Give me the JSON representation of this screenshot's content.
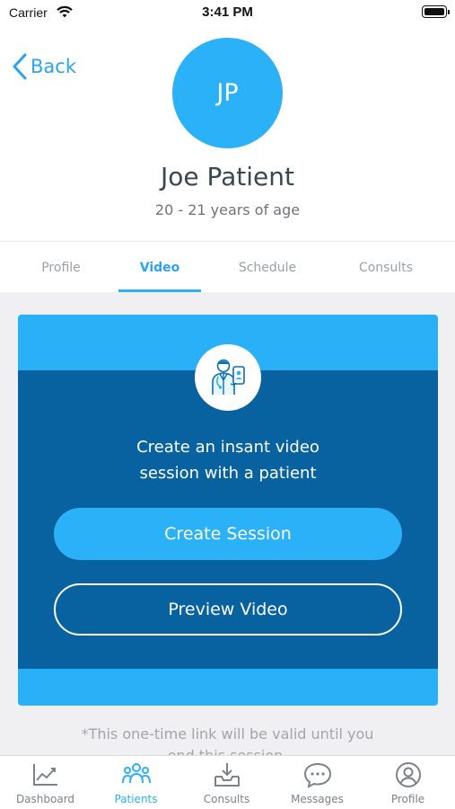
{
  "status_bar": {
    "carrier": "Carrier",
    "time": "3:41 PM"
  },
  "header": {
    "back_label": "Back",
    "avatar_initials": "JP",
    "patient_name": "Joe Patient",
    "patient_age": "20 - 21 years of age"
  },
  "tabs": [
    {
      "label": "Profile",
      "active": false
    },
    {
      "label": "Video",
      "active": true
    },
    {
      "label": "Schedule",
      "active": false
    },
    {
      "label": "Consults",
      "active": false
    }
  ],
  "video_card": {
    "text_line1": "Create an insant video",
    "text_line2": "session with a patient",
    "create_label": "Create Session",
    "preview_label": "Preview Video"
  },
  "footnote": {
    "line1": "*This one-time link will be valid until you",
    "line2": "end this session."
  },
  "bottom_nav": [
    {
      "label": "Dashboard",
      "icon": "chart-icon",
      "active": false
    },
    {
      "label": "Patients",
      "icon": "patients-icon",
      "active": true
    },
    {
      "label": "Consults",
      "icon": "inbox-icon",
      "active": false
    },
    {
      "label": "Messages",
      "icon": "chat-icon",
      "active": false
    },
    {
      "label": "Profile",
      "icon": "user-circle-icon",
      "active": false
    }
  ],
  "colors": {
    "accent": "#2ab1f8",
    "card_dark": "#0862a0",
    "tab_active": "#2ba3ee"
  }
}
